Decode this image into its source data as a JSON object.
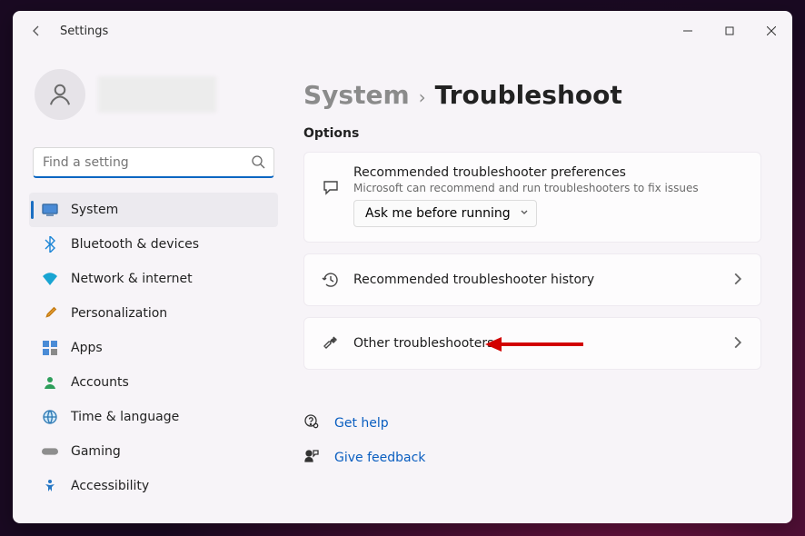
{
  "window": {
    "title": "Settings"
  },
  "search": {
    "placeholder": "Find a setting"
  },
  "sidebar": {
    "items": [
      {
        "label": "System",
        "icon": "display-icon",
        "selected": true
      },
      {
        "label": "Bluetooth & devices",
        "icon": "bluetooth-icon"
      },
      {
        "label": "Network & internet",
        "icon": "wifi-icon"
      },
      {
        "label": "Personalization",
        "icon": "brush-icon"
      },
      {
        "label": "Apps",
        "icon": "apps-icon"
      },
      {
        "label": "Accounts",
        "icon": "person-icon"
      },
      {
        "label": "Time & language",
        "icon": "globe-icon"
      },
      {
        "label": "Gaming",
        "icon": "gamepad-icon"
      },
      {
        "label": "Accessibility",
        "icon": "accessibility-icon"
      }
    ]
  },
  "breadcrumb": {
    "parent": "System",
    "current": "Troubleshoot"
  },
  "section": {
    "label": "Options"
  },
  "cards": {
    "pref": {
      "title": "Recommended troubleshooter preferences",
      "subtitle": "Microsoft can recommend and run troubleshooters to fix issues",
      "dropdown_value": "Ask me before running"
    },
    "history": {
      "title": "Recommended troubleshooter history"
    },
    "other": {
      "title": "Other troubleshooters"
    }
  },
  "links": {
    "help": "Get help",
    "feedback": "Give feedback"
  }
}
